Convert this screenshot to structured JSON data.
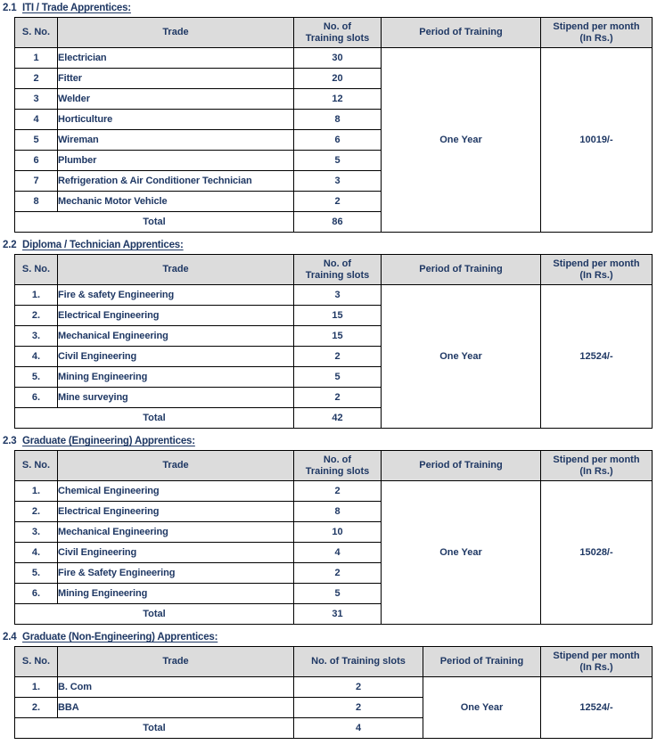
{
  "document": {
    "title": "Apprentice Training Slots",
    "text_color": "#1f3864",
    "header_bg": "#dcdcdc",
    "border_color": "#000000"
  },
  "common": {
    "headers": {
      "sno": "S. No.",
      "trade": "Trade",
      "slots_line1": "No. of",
      "slots_line2": "Training slots",
      "slots_single": "No. of Training slots",
      "period": "Period of Training",
      "stipend_line1": "Stipend per month",
      "stipend_line2": "(In Rs.)"
    },
    "total_label": "Total",
    "period_value": "One Year"
  },
  "sections": [
    {
      "number": "2.1",
      "title": "ITI / Trade Apprentices:",
      "period": "One Year",
      "stipend": "10019/-",
      "total_label": "Total",
      "total_slots": "86",
      "rows": [
        {
          "sno": "1",
          "trade": "Electrician",
          "slots": "30"
        },
        {
          "sno": "2",
          "trade": "Fitter",
          "slots": "20"
        },
        {
          "sno": "3",
          "trade": "Welder",
          "slots": "12"
        },
        {
          "sno": "4",
          "trade": "Horticulture",
          "slots": "8"
        },
        {
          "sno": "5",
          "trade": "Wireman",
          "slots": "6"
        },
        {
          "sno": "6",
          "trade": "Plumber",
          "slots": "5"
        },
        {
          "sno": "7",
          "trade": "Refrigeration & Air Conditioner Technician",
          "slots": "3"
        },
        {
          "sno": "8",
          "trade": "Mechanic Motor Vehicle",
          "slots": "2"
        }
      ]
    },
    {
      "number": "2.2",
      "title": "Diploma / Technician Apprentices:",
      "period": "One Year",
      "stipend": "12524/-",
      "total_label": "Total",
      "total_slots": "42",
      "rows": [
        {
          "sno": "1.",
          "trade": "Fire & safety Engineering",
          "slots": "3"
        },
        {
          "sno": "2.",
          "trade": "Electrical Engineering",
          "slots": "15"
        },
        {
          "sno": "3.",
          "trade": "Mechanical Engineering",
          "slots": "15"
        },
        {
          "sno": "4.",
          "trade": "Civil Engineering",
          "slots": "2"
        },
        {
          "sno": "5.",
          "trade": "Mining Engineering",
          "slots": "5"
        },
        {
          "sno": "6.",
          "trade": "Mine surveying",
          "slots": "2"
        }
      ]
    },
    {
      "number": "2.3",
      "title": "Graduate (Engineering) Apprentices:",
      "period": "One Year",
      "stipend": "15028/-",
      "total_label": "Total",
      "total_slots": "31",
      "rows": [
        {
          "sno": "1.",
          "trade": "Chemical Engineering",
          "slots": "2"
        },
        {
          "sno": "2.",
          "trade": "Electrical Engineering",
          "slots": "8"
        },
        {
          "sno": "3.",
          "trade": "Mechanical Engineering",
          "slots": "10"
        },
        {
          "sno": "4.",
          "trade": "Civil Engineering",
          "slots": "4"
        },
        {
          "sno": "5.",
          "trade": "Fire & Safety Engineering",
          "slots": "2"
        },
        {
          "sno": "6.",
          "trade": "Mining Engineering",
          "slots": "5"
        }
      ]
    },
    {
      "number": "2.4",
      "title": "Graduate (Non-Engineering) Apprentices:",
      "period": "One Year",
      "stipend": "12524/-",
      "total_label": "Total",
      "total_slots": "4",
      "rows": [
        {
          "sno": "1.",
          "trade": "B. Com",
          "slots": "2"
        },
        {
          "sno": "2.",
          "trade": "BBA",
          "slots": "2"
        }
      ]
    }
  ]
}
